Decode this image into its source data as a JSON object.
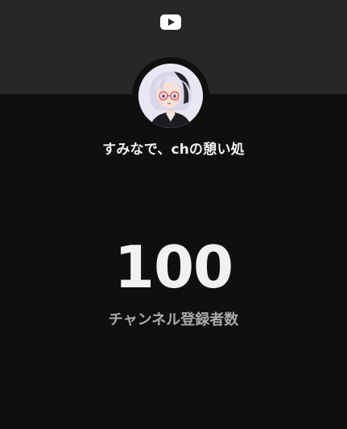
{
  "channel": {
    "name": "すみなで、chの憩い処",
    "avatar_icon": "anime-avatar-image"
  },
  "stats": {
    "subscriber_count": "100",
    "subscriber_label": "チャンネル登録者数"
  },
  "branding": {
    "logo_icon": "youtube-logo-icon",
    "banner_color": "#272727",
    "background_color": "#0f0f0f",
    "text_color": "#f1f1f1",
    "label_color": "#aaaaaa"
  }
}
